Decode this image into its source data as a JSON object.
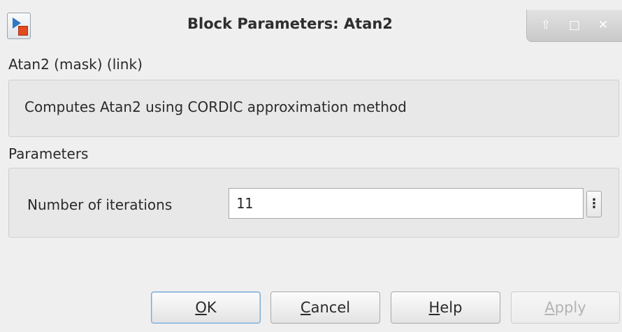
{
  "window": {
    "title": "Block Parameters: Atan2",
    "controls": {
      "up_icon": "⇧",
      "maximize_icon": "□",
      "close_icon": "✕"
    }
  },
  "block": {
    "header": "Atan2 (mask) (link)",
    "description": "Computes Atan2 using CORDIC approximation method"
  },
  "parameters": {
    "section_label": "Parameters",
    "iterations": {
      "label": "Number of iterations",
      "value": "11",
      "menu_icon": "⋮"
    }
  },
  "buttons": {
    "ok": {
      "mnemonic": "O",
      "rest": "K"
    },
    "cancel": {
      "mnemonic": "C",
      "rest": "ancel"
    },
    "help": {
      "mnemonic": "H",
      "rest": "elp"
    },
    "apply": {
      "mnemonic": "A",
      "rest": "pply",
      "enabled": false
    }
  }
}
